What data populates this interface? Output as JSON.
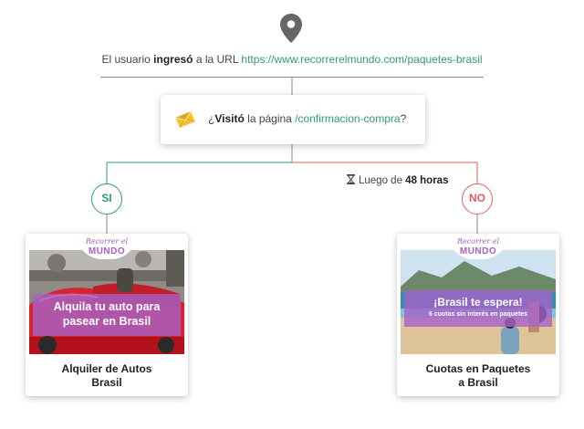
{
  "trigger": {
    "prefix": "El usuario ",
    "verb": "ingresó",
    "middle": " a la URL ",
    "url": "https://www.recorrerelmundo.com/paquetes-brasil"
  },
  "condition": {
    "open_q": "¿",
    "verb": "Visitó",
    "middle": " la página ",
    "path": "/confirmacion-compra",
    "close_q": "?"
  },
  "wait": {
    "prefix": "Luego de ",
    "duration": "48 horas"
  },
  "branches": {
    "yes": {
      "label": "SI",
      "color": "#2e9e6e",
      "card": {
        "logo_top": "Recorrer el",
        "logo_bottom": "MUNDO",
        "banner_line1": "Alquila tu auto para",
        "banner_line2": "pasear en Brasil",
        "caption_line1": "Alquiler de Autos",
        "caption_line2": "Brasil"
      }
    },
    "no": {
      "label": "NO",
      "color": "#e06060",
      "card": {
        "logo_top": "Recorrer el",
        "logo_bottom": "MUNDO",
        "banner_line1": "¡Brasil te espera!",
        "banner_line2": "6 cuotas sin interés en paquetes",
        "caption_line1": "Cuotas en Paquetes",
        "caption_line2": "a Brasil"
      }
    }
  },
  "colors": {
    "accent_green": "#2e9e6e",
    "accent_red": "#e06060",
    "brand_purple": "#a65fc4",
    "envelope_yellow": "#f2c12e"
  },
  "icons": {
    "trigger": "location-pin-icon",
    "condition": "envelope-icon",
    "wait": "hourglass-icon"
  }
}
